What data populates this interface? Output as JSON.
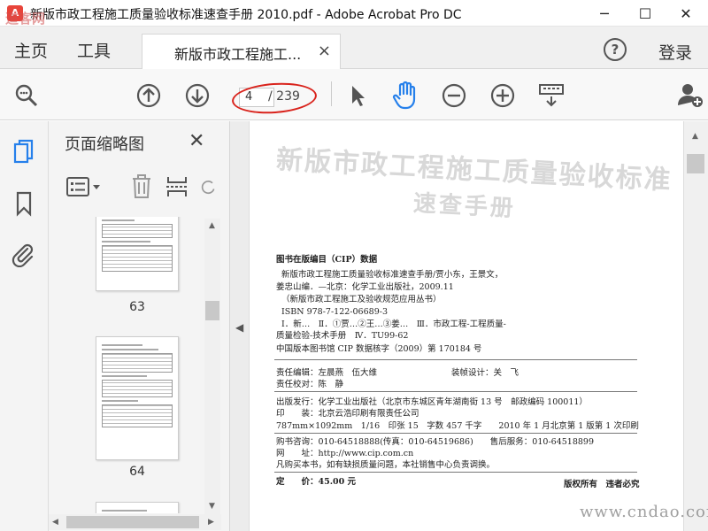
{
  "window": {
    "title": "新版市政工程施工质量验收标准速查手册 2010.pdf - Adobe Acrobat Pro DC",
    "logo_text": "A",
    "controls": {
      "minimize": "─",
      "maximize": "☐",
      "close": "✕"
    }
  },
  "tabs": {
    "home": "主页",
    "tools": "工具",
    "document": "新版市政工程施工...",
    "document_close": "×",
    "help": "?",
    "login": "登录"
  },
  "toolbar": {
    "page_input_value": "4",
    "page_total": "/ 239",
    "icons": [
      "zoom-search-icon",
      "page-up-icon",
      "page-down-icon",
      "select-arrow-icon",
      "hand-tool-icon",
      "zoom-out-icon",
      "zoom-in-icon",
      "keyboard-tools-icon",
      "add-user-icon"
    ]
  },
  "navrail": {
    "icons": [
      "page-thumbnails-icon",
      "bookmark-icon",
      "attachment-icon"
    ]
  },
  "thumbnail_panel": {
    "title": "页面缩略图",
    "close": "✕",
    "pages": [
      {
        "label": "63"
      },
      {
        "label": "64"
      }
    ]
  },
  "document": {
    "background_title_line1": "新版市政工程施工质量验收标准",
    "background_title_line2": "速查手册",
    "cip_heading": "图书在版编目（CIP）数据",
    "cip_lines": [
      "新版市政工程施工质量验收标准速查手册/贾小东，王景文，",
      "姜忠山编．—北京：化学工业出版社，2009.11",
      "（新版市政工程施工及验收规范应用丛书）",
      "ISBN 978-7-122-06689-3"
    ],
    "cip_class_lines": [
      "Ⅰ．新…　Ⅱ．①贾…②王…③姜…　Ⅲ．市政工程-工程质量-",
      "质量检验-技术手册　Ⅳ．TU99-62"
    ],
    "cip_data_number": "中国版本图书馆 CIP 数据核字（2009）第 170184 号",
    "editor": "责任编辑：左晨燕　伍大维",
    "designer": "装帧设计：关　飞",
    "proofreader": "责任校对：陈　静",
    "publisher": "出版发行：化学工业出版社（北京市东城区青年湖南街 13 号　邮政编码 100011）",
    "printer": "印　　装：北京云浩印刷有限责任公司",
    "specs": "787mm×1092mm　1/16　印张 15　字数 457 千字　　2010 年 1 月北京第 1 版第 1 次印刷",
    "purchase_phone": "购书咨询：010-64518888(传真：010-64519686)　　售后服务：010-64518899",
    "website": "网　　址：http://www.cip.com.cn",
    "notice": "凡购买本书，如有缺损质量问题，本社销售中心负责调换。",
    "price": "定　　价：45.00 元",
    "rights": "版权所有　违者必究"
  },
  "watermarks": {
    "top_left": "道客网",
    "bottom_right": "www.cndao.com"
  },
  "colors": {
    "annotation_red": "#d9231c",
    "hand_tool_blue": "#2680eb",
    "thumbnail_icon_blue": "#2680eb"
  }
}
